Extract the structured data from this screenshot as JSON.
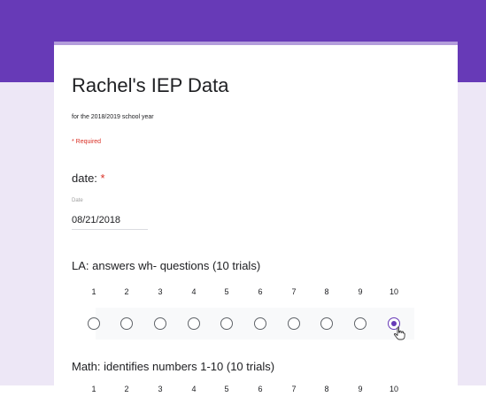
{
  "form": {
    "title": "Rachel's IEP Data",
    "description": "for the 2018/2019 school year",
    "required_note": "* Required",
    "accent_color": "#673ab7",
    "background_color": "#ede7f6"
  },
  "questions": [
    {
      "label": "date:",
      "required_marker": "*",
      "field_caption": "Date",
      "value": "08/21/2018"
    },
    {
      "label": "LA: answers wh- questions (10 trials)",
      "scale_labels": [
        "1",
        "2",
        "3",
        "4",
        "5",
        "6",
        "7",
        "8",
        "9",
        "10"
      ],
      "selected_value": "10"
    },
    {
      "label": "Math: identifies numbers 1-10 (10 trials)",
      "scale_labels": [
        "1",
        "2",
        "3",
        "4",
        "5",
        "6",
        "7",
        "8",
        "9",
        "10"
      ]
    }
  ],
  "cursor": {
    "icon": "hand-pointer-icon"
  }
}
